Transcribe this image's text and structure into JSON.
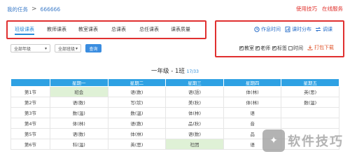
{
  "breadcrumb": {
    "root": "我的任务",
    "separator": ">",
    "current": "666666"
  },
  "top_links": [
    "使用技巧",
    "在线服务"
  ],
  "tabs": [
    "班级课表",
    "教师课表",
    "教室课表",
    "总课表",
    "总任课表",
    "课表质量"
  ],
  "actions": {
    "rest_time": "作息时间",
    "course_distribution": "课时分布",
    "adjust": "调课",
    "download": "打包下载"
  },
  "checkboxes": [
    {
      "label": "教室",
      "checked": true
    },
    {
      "label": "老师",
      "checked": true
    },
    {
      "label": "标签",
      "checked": true
    },
    {
      "label": "时间",
      "checked": false
    }
  ],
  "filters": {
    "grade": "全部年级",
    "group": "全部班级",
    "query_button": "查询"
  },
  "table": {
    "title": "一年级 - 1班",
    "subtitle": "17/33",
    "days": [
      "星期一",
      "星期二",
      "星期三",
      "星期四",
      "星期五"
    ],
    "rows": [
      {
        "period": "第1节",
        "cells": [
          "班会",
          "语(数)",
          "语(語)",
          "体(林)",
          "英(思)"
        ]
      },
      {
        "period": "第2节",
        "cells": [
          "语(数)",
          "写(钦)",
          "美(秋)",
          "体(林)",
          "数(温)"
        ]
      },
      {
        "period": "第3节",
        "cells": [
          "数(温)",
          "数(温)",
          "体(林)",
          "语",
          ""
        ]
      },
      {
        "period": "第4节",
        "cells": [
          "体(林)",
          "语(数)",
          "品(秋)",
          "音",
          ""
        ]
      },
      {
        "period": "第5节",
        "cells": [
          "语(数)",
          "体(林)",
          "语(数)",
          "品",
          ""
        ]
      },
      {
        "period": "第6节",
        "cells": [
          "科(温)",
          "英(思)",
          "社团",
          "语",
          ""
        ]
      }
    ],
    "highlighted": [
      [
        0,
        0
      ],
      [
        5,
        2
      ]
    ]
  },
  "watermark": {
    "text": "软件技巧"
  }
}
